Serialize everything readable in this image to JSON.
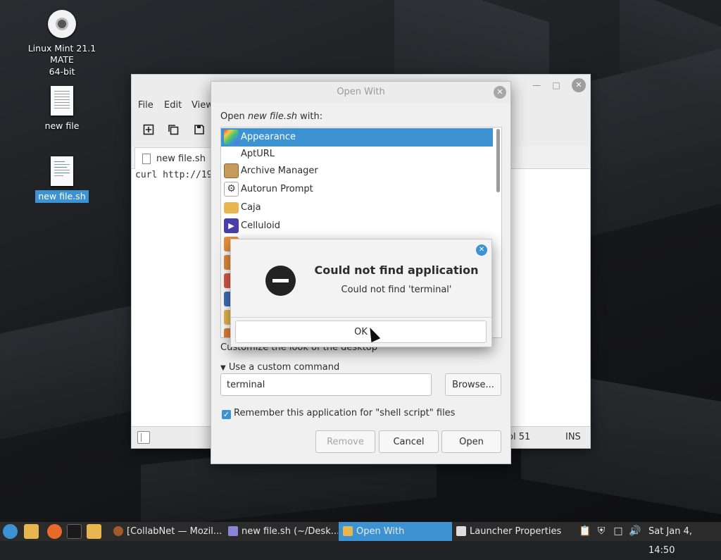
{
  "desktop": {
    "icons": [
      {
        "label_line1": "Linux Mint 21.1 MATE",
        "label_line2": "64-bit"
      },
      {
        "label": "new file"
      },
      {
        "label": "new file.sh"
      }
    ]
  },
  "editor": {
    "menu": {
      "file": "File",
      "edit": "Edit",
      "view": "View"
    },
    "tab_label": "new file.sh",
    "code_line": "curl http://19",
    "status": {
      "col": "ol 51",
      "mode": "INS"
    }
  },
  "open_with": {
    "title": "Open With",
    "label_prefix": "Open ",
    "label_file": "new file.sh",
    "label_suffix": " with:",
    "apps": [
      {
        "name": "Appearance",
        "icon": "appearance-icon",
        "color": "#8a5ad6"
      },
      {
        "name": "AptURL",
        "icon": "none",
        "color": ""
      },
      {
        "name": "Archive Manager",
        "icon": "archive-icon",
        "color": "#c79a5c"
      },
      {
        "name": "Autorun Prompt",
        "icon": "gear-icon",
        "color": "#444444"
      },
      {
        "name": "Caja",
        "icon": "folder-icon",
        "color": "#e8b64f"
      },
      {
        "name": "Celluloid",
        "icon": "play-icon",
        "color": "#4a3fa8"
      }
    ],
    "description": "Customize the look of the desktop",
    "expander_label": "Use a custom command",
    "command_value": "terminal",
    "browse_label": "Browse...",
    "remember_label": "Remember this application for \"shell script\" files",
    "remember_checked": true,
    "remove_label": "Remove",
    "cancel_label": "Cancel",
    "open_label": "Open"
  },
  "error_dialog": {
    "title": "Could not find application",
    "message": "Could not find 'terminal'",
    "ok_label": "OK"
  },
  "taskbar": {
    "tasks": [
      {
        "label": "[CollabNet — Mozil...",
        "active": false
      },
      {
        "label": "new file.sh (~/Desk...",
        "active": false
      },
      {
        "label": "Open With",
        "active": true
      },
      {
        "label": "Launcher Properties",
        "active": false
      }
    ],
    "clock": "Sat Jan  4, 14:50"
  },
  "colors": {
    "accent": "#3d93d1",
    "taskbar": "#2b2b2b"
  }
}
